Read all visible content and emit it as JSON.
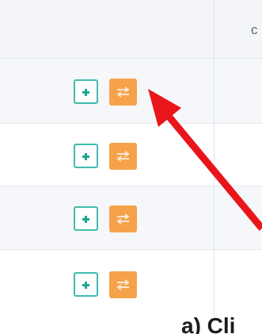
{
  "table": {
    "header": {
      "column_label": "c"
    },
    "rows": [
      {
        "add_icon": "plus-icon",
        "transfer_icon": "swap-icon"
      },
      {
        "add_icon": "plus-icon",
        "transfer_icon": "swap-icon"
      },
      {
        "add_icon": "plus-icon",
        "transfer_icon": "swap-icon"
      },
      {
        "add_icon": "plus-icon",
        "transfer_icon": "swap-icon"
      }
    ]
  },
  "annotation": {
    "caption": "a) Cli",
    "arrow_icon": "arrow-icon",
    "arrow_color": "#e8161b"
  },
  "colors": {
    "add_button_border": "#3fbcae",
    "add_button_icon": "#1fa58f",
    "transfer_button": "#f5a24a",
    "row_alt": "#f5f7fa",
    "header_bg": "#f3f5f8"
  }
}
